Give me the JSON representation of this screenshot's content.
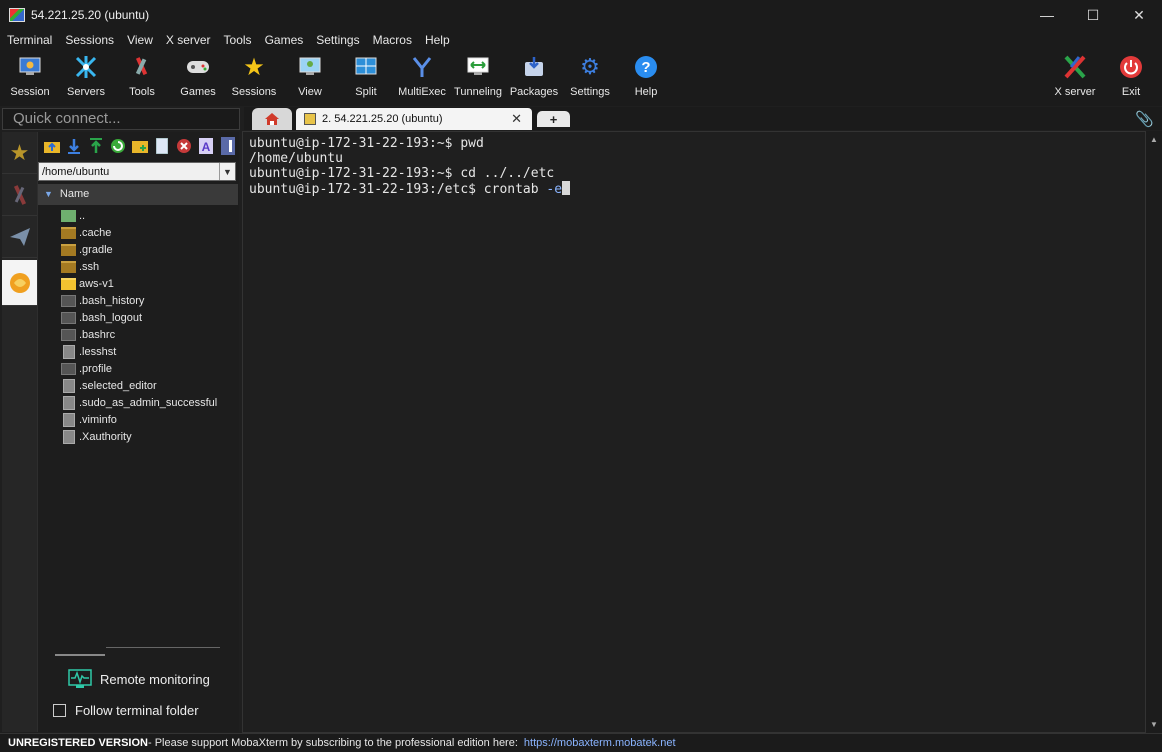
{
  "window": {
    "title": "54.221.25.20 (ubuntu)"
  },
  "menu": [
    "Terminal",
    "Sessions",
    "View",
    "X server",
    "Tools",
    "Games",
    "Settings",
    "Macros",
    "Help"
  ],
  "toolbar": {
    "session": "Session",
    "servers": "Servers",
    "tools": "Tools",
    "games": "Games",
    "sessions": "Sessions",
    "view": "View",
    "split": "Split",
    "multiexec": "MultiExec",
    "tunneling": "Tunneling",
    "packages": "Packages",
    "settings": "Settings",
    "help": "Help",
    "xserver": "X server",
    "exit": "Exit"
  },
  "quick_connect": {
    "placeholder": "Quick connect..."
  },
  "sftp": {
    "path": "/home/ubuntu",
    "header_name": "Name",
    "files": [
      {
        "name": "..",
        "type": "up"
      },
      {
        "name": ".cache",
        "type": "folder"
      },
      {
        "name": ".gradle",
        "type": "folder"
      },
      {
        "name": ".ssh",
        "type": "folder"
      },
      {
        "name": "aws-v1",
        "type": "folder-bright"
      },
      {
        "name": ".bash_history",
        "type": "file-dark"
      },
      {
        "name": ".bash_logout",
        "type": "file-dark"
      },
      {
        "name": ".bashrc",
        "type": "file-dark"
      },
      {
        "name": ".lesshst",
        "type": "file-doc"
      },
      {
        "name": ".profile",
        "type": "file-dark"
      },
      {
        "name": ".selected_editor",
        "type": "file-doc"
      },
      {
        "name": ".sudo_as_admin_successful",
        "type": "file-doc"
      },
      {
        "name": ".viminfo",
        "type": "file-doc"
      },
      {
        "name": ".Xauthority",
        "type": "file-doc"
      }
    ],
    "remote_monitoring": "Remote monitoring",
    "follow_folder": "Follow terminal folder"
  },
  "tabs": {
    "session_tab": "2. 54.221.25.20 (ubuntu)"
  },
  "terminal": {
    "line1": "ubuntu@ip-172-31-22-193:~$ pwd",
    "line2": "/home/ubuntu",
    "line3": "ubuntu@ip-172-31-22-193:~$ cd ../../etc",
    "line4_prompt": "ubuntu@ip-172-31-22-193:/etc$ crontab ",
    "line4_flag": "-e"
  },
  "status": {
    "unregistered": "UNREGISTERED VERSION",
    "message": " -  Please support MobaXterm by subscribing to the professional edition here:",
    "link": "https://mobaxterm.mobatek.net"
  }
}
